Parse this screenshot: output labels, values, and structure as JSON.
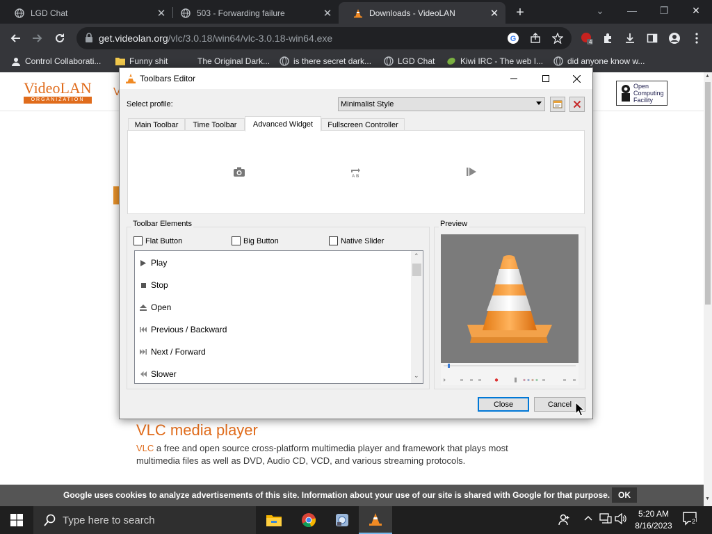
{
  "browser": {
    "tabs": [
      {
        "title": "LGD Chat",
        "icon": "globe-icon",
        "active": false
      },
      {
        "title": "503 - Forwarding failure",
        "icon": "globe-icon",
        "active": false
      },
      {
        "title": "Downloads - VideoLAN",
        "icon": "vlc-cone-icon",
        "active": true
      }
    ],
    "url_host": "get.videolan.org",
    "url_path": "/vlc/3.0.18/win64/vlc-3.0.18-win64.exe",
    "extension_badge": "4",
    "bookmarks": [
      {
        "label": "Control Collaborati...",
        "icon": "user-icon"
      },
      {
        "label": "Funny shit",
        "icon": "folder-icon"
      },
      {
        "label": "The Original Dark...",
        "icon": "blank-icon"
      },
      {
        "label": "is there secret dark...",
        "icon": "globe-icon"
      },
      {
        "label": "LGD Chat",
        "icon": "globe-icon"
      },
      {
        "label": "Kiwi IRC - The web I...",
        "icon": "kiwi-icon"
      },
      {
        "label": "did anyone know w...",
        "icon": "globe-icon"
      }
    ]
  },
  "page": {
    "logo_top": "VideoLAN",
    "logo_bottom": "ORGANIZATION",
    "partial_heading": "V",
    "ocf_logo": [
      "Open",
      "Computing",
      "Facility"
    ],
    "vlc_title": "VLC media player",
    "vlc_link": "VLC",
    "vlc_desc": " a free and open source cross-platform multimedia player and framework that plays most multimedia files as well as DVD, Audio CD, VCD, and various streaming protocols.",
    "cookie_text": "Google uses cookies to analyze advertisements of this site. Information about your use of our site is shared with Google for that purpose.",
    "cookie_ok": "OK"
  },
  "dialog": {
    "title": "Toolbars Editor",
    "select_profile_label": "Select profile:",
    "profile_value": "Minimalist Style",
    "tabs": [
      "Main Toolbar",
      "Time Toolbar",
      "Advanced Widget",
      "Fullscreen Controller"
    ],
    "active_tab": "Advanced Widget",
    "widgets": [
      "snapshot-icon",
      "ab-loop-icon",
      "frame-by-frame-icon"
    ],
    "toolbar_elements_label": "Toolbar Elements",
    "checkboxes": [
      {
        "label": "Flat Button",
        "checked": false
      },
      {
        "label": "Big Button",
        "checked": false
      },
      {
        "label": "Native Slider",
        "checked": false
      }
    ],
    "elements": [
      {
        "label": "Play",
        "icon": "play-icon"
      },
      {
        "label": "Stop",
        "icon": "stop-icon"
      },
      {
        "label": "Open",
        "icon": "eject-icon"
      },
      {
        "label": "Previous / Backward",
        "icon": "previous-icon"
      },
      {
        "label": "Next / Forward",
        "icon": "next-icon"
      },
      {
        "label": "Slower",
        "icon": "slower-icon"
      }
    ],
    "preview_label": "Preview",
    "close_label": "Close",
    "cancel_label": "Cancel"
  },
  "taskbar": {
    "search_placeholder": "Type here to search",
    "time": "5:20 AM",
    "date": "8/16/2023",
    "notification_count": "2",
    "apps": [
      "file-explorer-icon",
      "chrome-icon",
      "network-app-icon",
      "vlc-cone-icon"
    ]
  },
  "colors": {
    "accent": "#e06c1c",
    "chrome_dark": "#202124",
    "chrome_bar": "#35363a",
    "win_blue": "#0078d7"
  }
}
